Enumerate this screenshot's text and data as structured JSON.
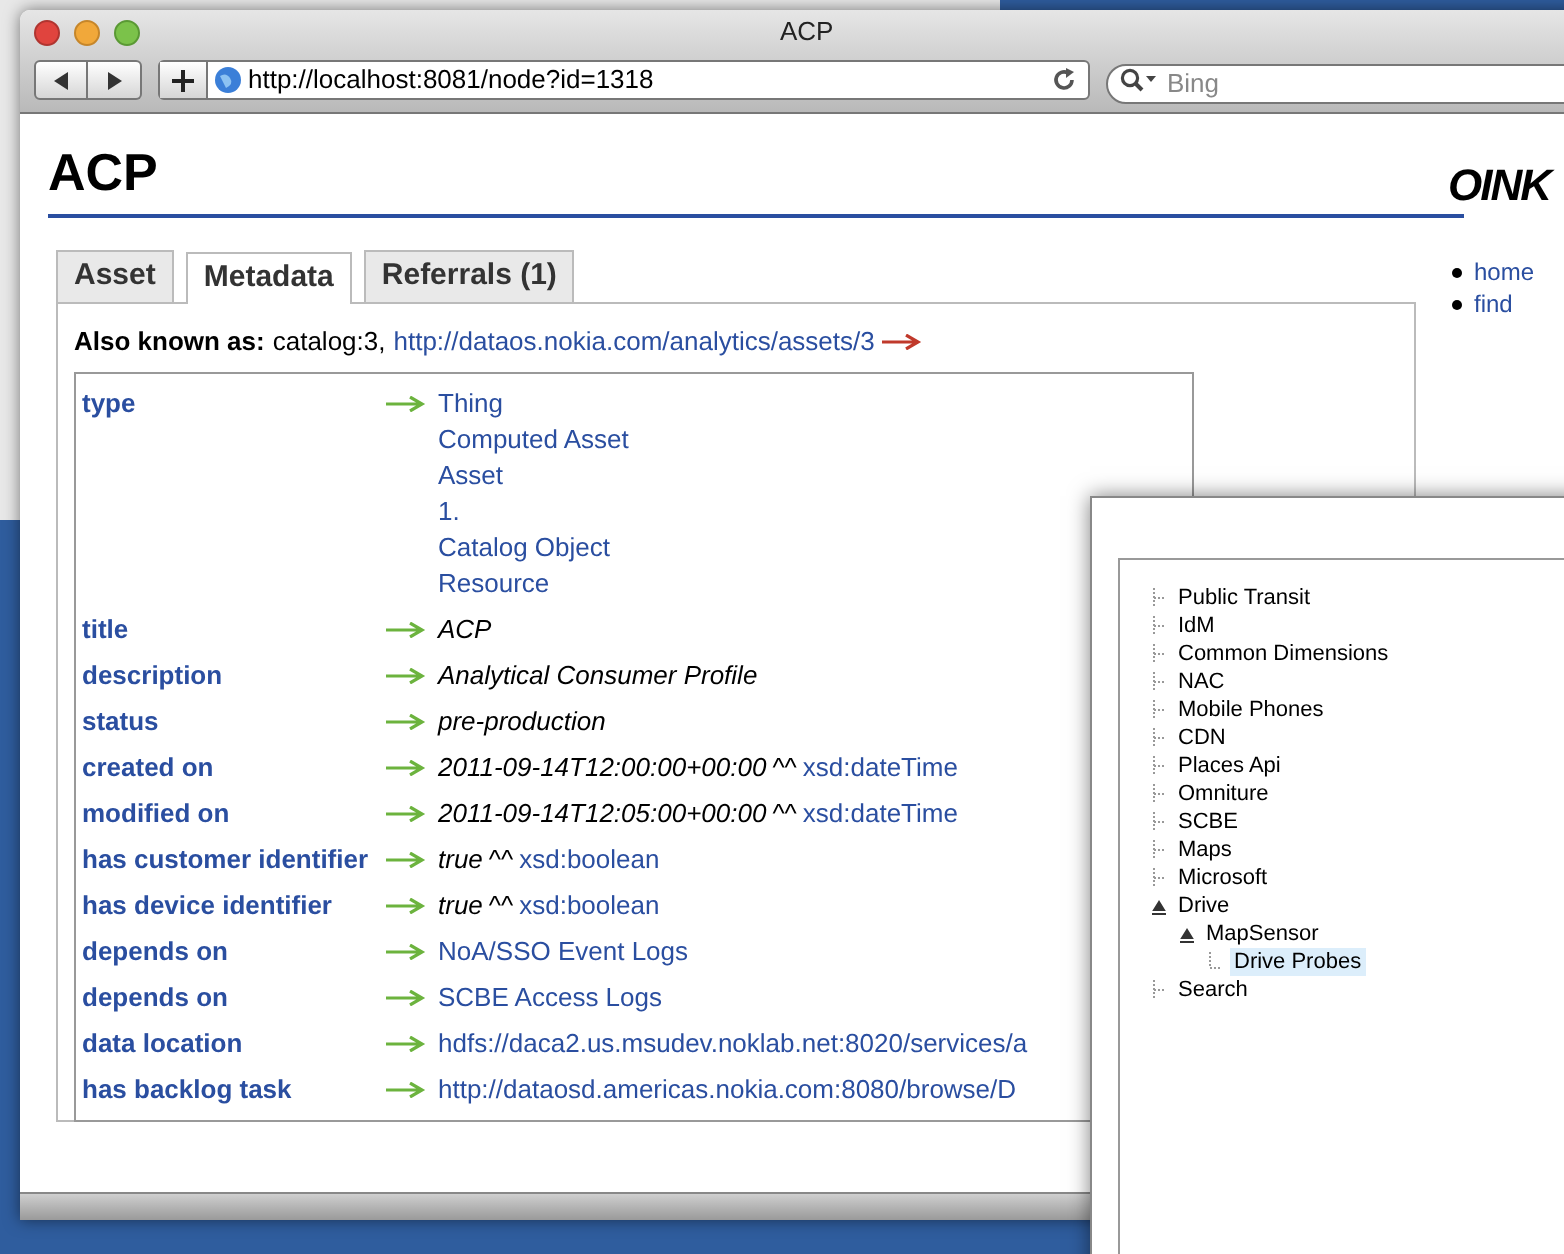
{
  "window": {
    "title": "ACP"
  },
  "toolbar": {
    "url": "http://localhost:8081/node?id=1318",
    "search": {
      "placeholder": "Bing"
    }
  },
  "page": {
    "heading": "ACP",
    "logo": "OINK",
    "nav_links": [
      "home",
      "find"
    ],
    "tabs": [
      {
        "label": "Asset",
        "selected": false
      },
      {
        "label": "Metadata",
        "selected": true
      },
      {
        "label": "Referrals (1)",
        "selected": false
      }
    ],
    "also_known_as": {
      "label": "Also known as:",
      "values": [
        {
          "kind": "plain",
          "text": "catalog:3,"
        },
        {
          "kind": "link",
          "text": "http://dataos.nokia.com/analytics/assets/3"
        }
      ]
    },
    "properties": [
      {
        "name": "type",
        "values": [
          {
            "kind": "link",
            "text": "Thing"
          },
          {
            "kind": "link",
            "text": "Computed Asset"
          },
          {
            "kind": "link",
            "text": "Asset"
          },
          {
            "kind": "link",
            "text": "1."
          },
          {
            "kind": "link",
            "text": "Catalog Object"
          },
          {
            "kind": "link",
            "text": "Resource"
          }
        ]
      },
      {
        "name": "title",
        "values": [
          {
            "kind": "literal",
            "text": "ACP"
          }
        ]
      },
      {
        "name": "description",
        "values": [
          {
            "kind": "literal",
            "text": "Analytical Consumer Profile"
          }
        ]
      },
      {
        "name": "status",
        "values": [
          {
            "kind": "literal",
            "text": "pre-production"
          }
        ]
      },
      {
        "name": "created on",
        "values": [
          {
            "kind": "typed",
            "text": "2011-09-14T12:00:00+00:00",
            "marker": "^^",
            "datatype": "xsd:dateTime"
          }
        ]
      },
      {
        "name": "modified on",
        "values": [
          {
            "kind": "typed",
            "text": "2011-09-14T12:05:00+00:00",
            "marker": "^^",
            "datatype": "xsd:dateTime"
          }
        ]
      },
      {
        "name": "has customer identifier",
        "values": [
          {
            "kind": "typed",
            "text": "true",
            "marker": "^^",
            "datatype": "xsd:boolean"
          }
        ]
      },
      {
        "name": "has device identifier",
        "values": [
          {
            "kind": "typed",
            "text": "true",
            "marker": "^^",
            "datatype": "xsd:boolean"
          }
        ]
      },
      {
        "name": "depends on",
        "values": [
          {
            "kind": "link",
            "text": "NoA/SSO Event Logs"
          }
        ]
      },
      {
        "name": "depends on",
        "values": [
          {
            "kind": "link",
            "text": "SCBE Access Logs"
          }
        ]
      },
      {
        "name": "data location",
        "values": [
          {
            "kind": "link",
            "text": "hdfs://daca2.us.msudev.noklab.net:8020/services/a"
          }
        ]
      },
      {
        "name": "has backlog task",
        "values": [
          {
            "kind": "link",
            "text": "http://dataosd.americas.nokia.com:8080/browse/D"
          }
        ]
      }
    ]
  },
  "tree": [
    {
      "label": "Public Transit",
      "expanded": false,
      "selected": false
    },
    {
      "label": "IdM",
      "expanded": false,
      "selected": false
    },
    {
      "label": "Common Dimensions",
      "expanded": false,
      "selected": false
    },
    {
      "label": "NAC",
      "expanded": false,
      "selected": false
    },
    {
      "label": "Mobile Phones",
      "expanded": false,
      "selected": false
    },
    {
      "label": "CDN",
      "expanded": false,
      "selected": false
    },
    {
      "label": "Places Api",
      "expanded": false,
      "selected": false
    },
    {
      "label": "Omniture",
      "expanded": false,
      "selected": false
    },
    {
      "label": "SCBE",
      "expanded": false,
      "selected": false
    },
    {
      "label": "Maps",
      "expanded": false,
      "selected": false
    },
    {
      "label": "Microsoft",
      "expanded": false,
      "selected": false
    },
    {
      "label": "Drive",
      "expanded": true,
      "selected": false,
      "children": [
        {
          "label": "MapSensor",
          "expanded": true,
          "selected": false,
          "children": [
            {
              "label": "Drive Probes",
              "selected": true
            }
          ]
        }
      ]
    },
    {
      "label": "Search",
      "expanded": false,
      "selected": false
    }
  ]
}
